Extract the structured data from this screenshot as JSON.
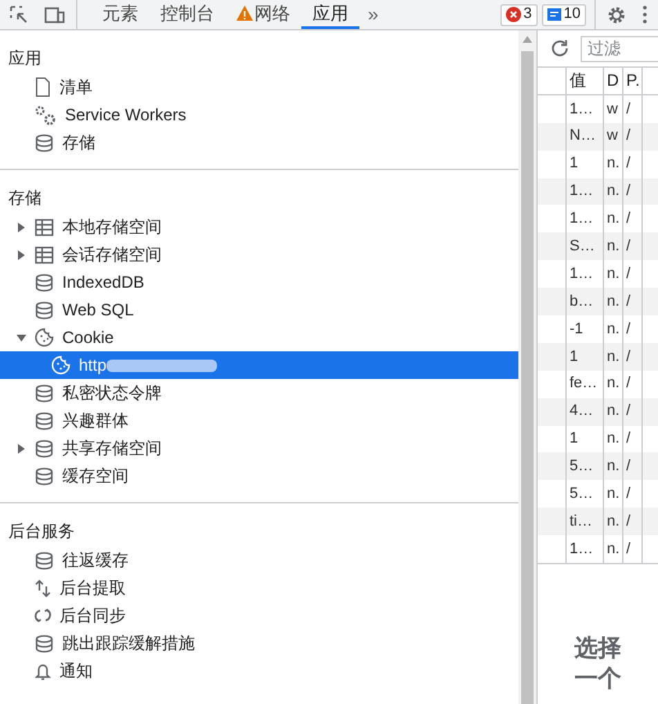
{
  "toolbar": {
    "tabs": [
      {
        "label": "元素",
        "selected": false,
        "warning": false
      },
      {
        "label": "控制台",
        "selected": false,
        "warning": false
      },
      {
        "label": "网络",
        "selected": false,
        "warning": true
      },
      {
        "label": "应用",
        "selected": true,
        "warning": false
      }
    ],
    "more": "»",
    "errors": "3",
    "messages": "10"
  },
  "sidebar": {
    "sections": [
      {
        "title": "应用",
        "items": [
          {
            "label": "清单",
            "kind": "file"
          },
          {
            "label": "Service Workers",
            "kind": "gears"
          },
          {
            "label": "存储",
            "kind": "db"
          }
        ]
      },
      {
        "title": "存储",
        "items": [
          {
            "label": "本地存储空间",
            "kind": "table",
            "expanded": false
          },
          {
            "label": "会话存储空间",
            "kind": "table",
            "expanded": false
          },
          {
            "label": "IndexedDB",
            "kind": "db"
          },
          {
            "label": "Web SQL",
            "kind": "db"
          },
          {
            "label": "Cookie",
            "kind": "cookie",
            "expanded": true,
            "children": [
              {
                "label": "http",
                "kind": "cookie",
                "selected": true,
                "redacted": true
              }
            ]
          },
          {
            "label": "私密状态令牌",
            "kind": "db"
          },
          {
            "label": "兴趣群体",
            "kind": "db"
          },
          {
            "label": "共享存储空间",
            "kind": "db",
            "expanded": false
          },
          {
            "label": "缓存空间",
            "kind": "db"
          }
        ]
      },
      {
        "title": "后台服务",
        "items": [
          {
            "label": "往返缓存",
            "kind": "db"
          },
          {
            "label": "后台提取",
            "kind": "updown"
          },
          {
            "label": "后台同步",
            "kind": "sync"
          },
          {
            "label": "跳出跟踪缓解措施",
            "kind": "db"
          },
          {
            "label": "通知",
            "kind": "bell"
          }
        ]
      }
    ]
  },
  "cookies": {
    "filter": {
      "placeholder": "过滤"
    },
    "columns": [
      "值",
      "D",
      "P."
    ],
    "rows": [
      {
        "value": "1…",
        "domain": "w",
        "path": "/"
      },
      {
        "value": "N…",
        "domain": "w",
        "path": "/"
      },
      {
        "value": "1",
        "domain": "n.",
        "path": "/"
      },
      {
        "value": "1…",
        "domain": "n.",
        "path": "/"
      },
      {
        "value": "1…",
        "domain": "n.",
        "path": "/"
      },
      {
        "value": "S…",
        "domain": "n.",
        "path": "/"
      },
      {
        "value": "1…",
        "domain": "n.",
        "path": "/"
      },
      {
        "value": "b…",
        "domain": "n.",
        "path": "/"
      },
      {
        "value": "-1",
        "domain": "n.",
        "path": "/"
      },
      {
        "value": "1",
        "domain": "n.",
        "path": "/"
      },
      {
        "value": "fe…",
        "domain": "n.",
        "path": "/"
      },
      {
        "value": "4…",
        "domain": "n.",
        "path": "/"
      },
      {
        "value": "1",
        "domain": "n.",
        "path": "/"
      },
      {
        "value": "5…",
        "domain": "n.",
        "path": "/"
      },
      {
        "value": "5…",
        "domain": "n.",
        "path": "/"
      },
      {
        "value": "ti…",
        "domain": "n.",
        "path": "/"
      },
      {
        "value": "1…",
        "domain": "n.",
        "path": "/"
      }
    ],
    "empty_message": [
      "选择",
      "一个"
    ]
  }
}
